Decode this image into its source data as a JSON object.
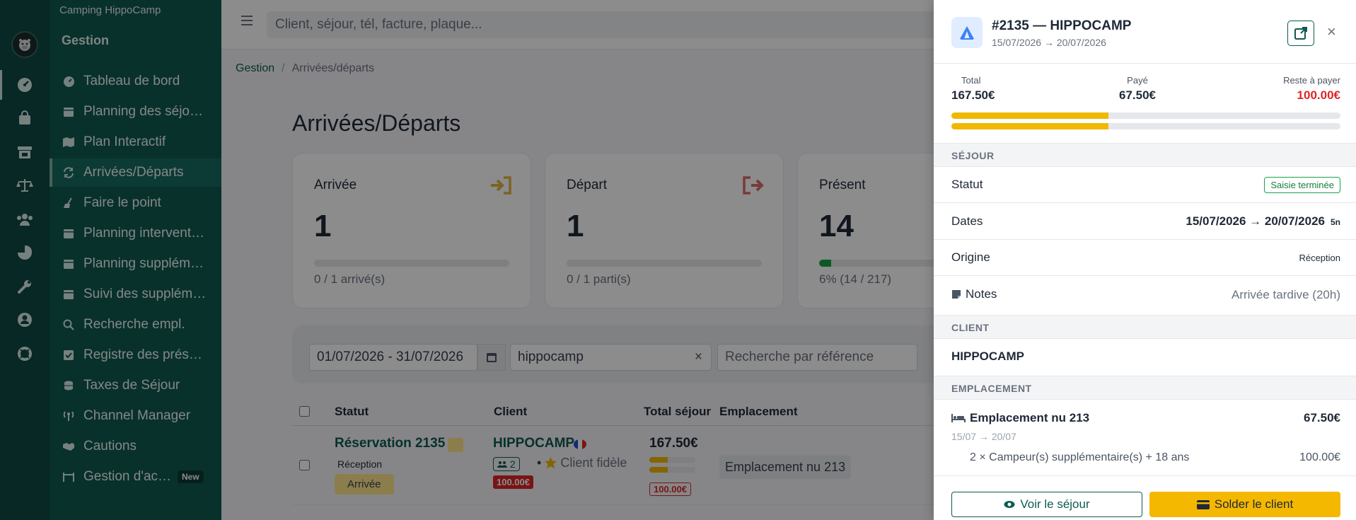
{
  "colors": {
    "brand": "#0f5a50",
    "accent": "#f5b800",
    "danger": "#dc2626",
    "success": "#16a34a"
  },
  "rail": {
    "icons": [
      "dashboard-icon",
      "bag-icon",
      "store-icon",
      "balance-icon",
      "users-icon",
      "pie-chart-icon",
      "wrench-icon",
      "user-circle-icon",
      "lifebuoy-icon"
    ]
  },
  "sidebar": {
    "app_name": "Camping HippoCamp",
    "section": "Gestion",
    "items": [
      {
        "label": "Tableau de bord",
        "icon": "dashboard-icon"
      },
      {
        "label": "Planning des séjours",
        "icon": "calendar-icon"
      },
      {
        "label": "Plan Interactif",
        "icon": "map-icon"
      },
      {
        "label": "Arrivées/Départs",
        "icon": "sync-icon",
        "active": true
      },
      {
        "label": "Faire le point",
        "icon": "broom-icon"
      },
      {
        "label": "Planning interventions",
        "icon": "calendar-icon"
      },
      {
        "label": "Planning suppléments",
        "icon": "calendar-icon"
      },
      {
        "label": "Suivi des suppléments",
        "icon": "calendar-icon"
      },
      {
        "label": "Recherche empl.",
        "icon": "search-icon"
      },
      {
        "label": "Registre des présences",
        "icon": "checkbox-icon"
      },
      {
        "label": "Taxes de Séjour",
        "icon": "coins-icon"
      },
      {
        "label": "Channel Manager",
        "icon": "antenna-icon"
      },
      {
        "label": "Cautions",
        "icon": "handshake-icon"
      },
      {
        "label": "Gestion d'accès",
        "icon": "barrier-icon",
        "badge": "New"
      }
    ]
  },
  "topbar": {
    "search_placeholder": "Client, séjour, tél, facture, plaque..."
  },
  "breadcrumb": {
    "root": "Gestion",
    "sep": "/",
    "current": "Arrivées/départs"
  },
  "page_title": "Arrivées/Départs",
  "cards": [
    {
      "title": "Arrivée",
      "value": "1",
      "sub": "0 / 1 arrivé(s)",
      "progress": 0,
      "icon": "sign-in-icon",
      "icon_color": "#e3b341"
    },
    {
      "title": "Départ",
      "value": "1",
      "sub": "0 / 1 parti(s)",
      "progress": 0,
      "icon": "sign-out-icon",
      "icon_color": "#dc6b6b"
    },
    {
      "title": "Présent",
      "value": "14",
      "sub": "6% (14 / 217)",
      "progress": 0.06,
      "icon": "",
      "icon_color": ""
    }
  ],
  "filters": {
    "date_range": "01/07/2026 - 31/07/2026",
    "client": "hippocamp",
    "clear": "×",
    "ref_placeholder": "Recherche par référence"
  },
  "table": {
    "headers": {
      "status": "Statut",
      "client": "Client",
      "total": "Total séjour",
      "location": "Emplacement"
    },
    "rows": [
      {
        "reservation": "Réservation 2135",
        "source": "Réception",
        "status": "Arrivée",
        "client": "HIPPOCAMP",
        "group": "2",
        "loyalty": "Client fidèle",
        "due": "100.00€",
        "total": "167.50€",
        "total_due": "100.00€",
        "location": "Emplacement nu 213"
      }
    ]
  },
  "drawer": {
    "title": "#2135 — HIPPOCAMP",
    "subtitle": "15/07/2026 → 20/07/2026",
    "close": "×",
    "amounts": {
      "total_label": "Total",
      "total": "167.50€",
      "paid_label": "Payé",
      "paid": "67.50€",
      "rest_label": "Reste à payer",
      "rest": "100.00€",
      "paid_ratio": 0.403
    },
    "sejour_header": "SÉJOUR",
    "status_label": "Statut",
    "status_value": "Saisie terminée",
    "dates_label": "Dates",
    "dates_value": "15/07/2026 → 20/07/2026",
    "nights": "5n",
    "origin_label": "Origine",
    "origin_value": "Réception",
    "notes_label": "Notes",
    "notes_value": "Arrivée tardive (20h)",
    "client_header": "CLIENT",
    "client_name": "HIPPOCAMP",
    "location_header": "EMPLACEMENT",
    "location_name": "Emplacement nu 213",
    "location_price": "67.50€",
    "location_dates": "15/07 → 20/07",
    "extra_label": "2 × Campeur(s) supplémentaire(s) + 18 ans",
    "extra_price": "100.00€",
    "view_button": "Voir le séjour",
    "settle_button": "Solder le client"
  }
}
